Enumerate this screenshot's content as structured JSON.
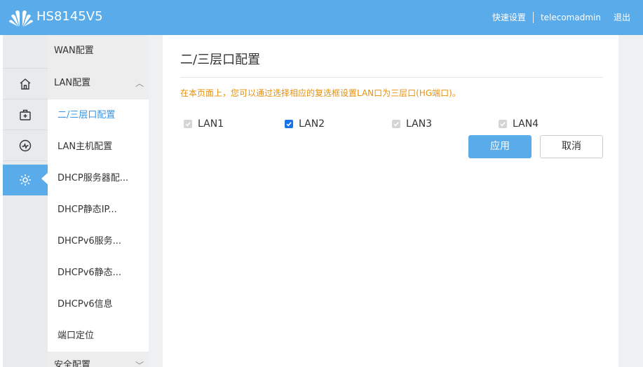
{
  "header": {
    "model": "HS8145V5",
    "links": [
      "快速设置",
      "telecomadmin",
      "退出"
    ]
  },
  "rail": {
    "items": [
      {
        "icon": "home-icon"
      },
      {
        "icon": "first-aid-kit-icon"
      },
      {
        "icon": "gauge-icon"
      },
      {
        "icon": "gear-icon",
        "active": true
      }
    ]
  },
  "submenu": {
    "group_wan": "WAN配置",
    "group_lan": "LAN配置",
    "items": [
      "二/三层口配置",
      "LAN主机配置",
      "DHCP服务器配...",
      "DHCP静态IP...",
      "DHCPv6服务...",
      "DHCPv6静态...",
      "DHCPv6信息",
      "端口定位"
    ],
    "group_security": "安全配置"
  },
  "main": {
    "title": "二/三层口配置",
    "notice": "在本页面上，您可以通过选择相应的复选框设置LAN口为三层口(HG端口)。",
    "ports": [
      {
        "label": "LAN1",
        "checked": true,
        "disabled": true
      },
      {
        "label": "LAN2",
        "checked": true,
        "disabled": false
      },
      {
        "label": "LAN3",
        "checked": true,
        "disabled": true
      },
      {
        "label": "LAN4",
        "checked": true,
        "disabled": true
      }
    ],
    "apply_label": "应用",
    "cancel_label": "取消"
  },
  "colors": {
    "header": "#5aabe9",
    "accent": "#3b95e3",
    "notice": "#e8900a"
  }
}
